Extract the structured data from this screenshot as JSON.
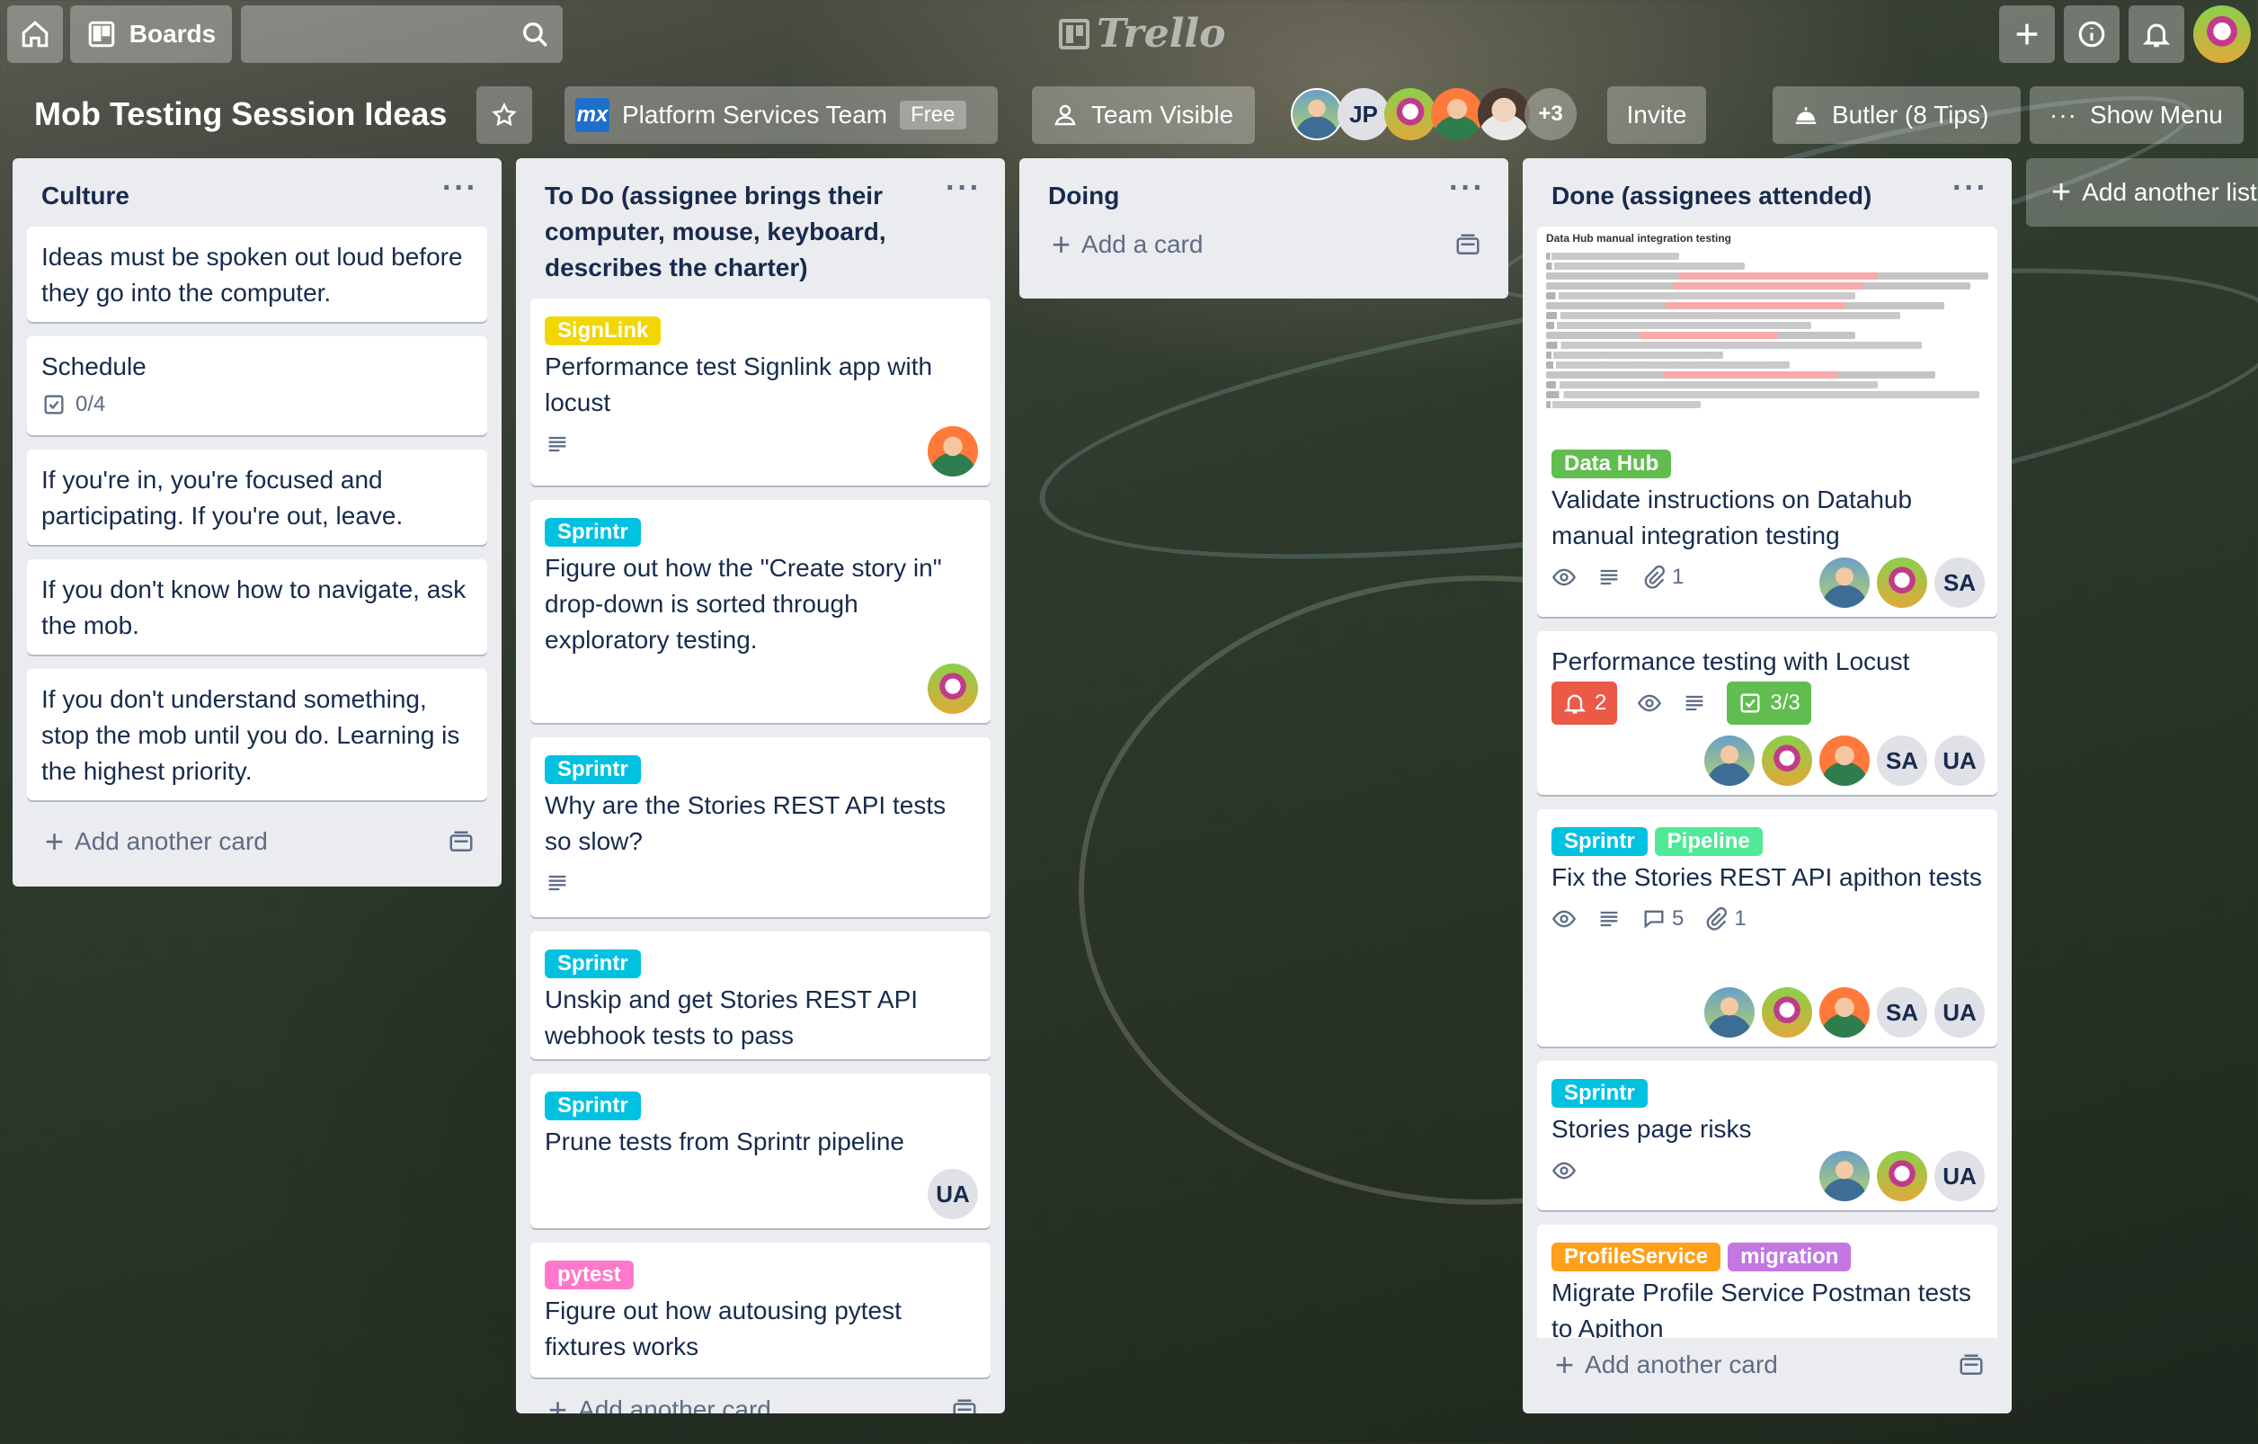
{
  "topbar": {
    "home_icon": "home-icon",
    "boards_label": "Boards",
    "search_placeholder": "",
    "logo_text": "Trello"
  },
  "header": {
    "board_title": "Mob Testing Session Ideas",
    "team_icon_text": "mx",
    "team_name": "Platform Services Team",
    "team_plan": "Free",
    "visibility": "Team Visible",
    "member_initials": "JP",
    "more_members": "+3",
    "invite_label": "Invite",
    "butler_label": "Butler (8 Tips)",
    "menu_label": "Show Menu",
    "add_list_label": "Add another list"
  },
  "lists": [
    {
      "title": "Culture",
      "cards": [
        {
          "text": "Ideas must be spoken out loud before they go into the computer."
        },
        {
          "text": "Schedule",
          "checklist": "0/4"
        },
        {
          "text": "If you're in, you're focused and participating. If you're out, leave."
        },
        {
          "text": "If you don't know how to navigate, ask the mob."
        },
        {
          "text": "If you don't understand something, stop the mob until you do. Learning is the highest priority."
        }
      ],
      "add_label": "Add another card"
    },
    {
      "title": "To Do (assignee brings their computer, mouse, keyboard, describes the charter)",
      "cards": [
        {
          "label": "SignLink",
          "text": "Performance test Signlink app with locust"
        },
        {
          "label": "Sprintr",
          "text": "Figure out how the \"Create story in\" drop-down is sorted through exploratory testing."
        },
        {
          "label": "Sprintr",
          "text": "Why are the Stories REST API tests so slow?"
        },
        {
          "label": "Sprintr",
          "text": "Unskip and get Stories REST API webhook tests to pass"
        },
        {
          "label": "Sprintr",
          "text": "Prune tests from Sprintr pipeline",
          "member": "UA"
        },
        {
          "label": "pytest",
          "text": "Figure out how autousing pytest fixtures works"
        }
      ],
      "add_label": "Add another card"
    },
    {
      "title": "Doing",
      "add_label": "Add a card"
    },
    {
      "title": "Done (assignees attended)",
      "cards": [
        {
          "cover_title": "Data Hub manual integration testing",
          "label": "Data Hub",
          "text": "Validate instructions on Datahub manual integration testing",
          "attachments": "1",
          "member": "SA"
        },
        {
          "text": "Performance testing with Locust",
          "due": "2",
          "checklist": "3/3",
          "members": [
            "SA",
            "UA"
          ]
        },
        {
          "labels": [
            "Sprintr",
            "Pipeline"
          ],
          "text": "Fix the Stories REST API apithon tests",
          "comments": "5",
          "attachments": "1",
          "members": [
            "SA",
            "UA"
          ]
        },
        {
          "label": "Sprintr",
          "text": "Stories page risks",
          "member": "UA"
        },
        {
          "labels": [
            "ProfileService",
            "migration"
          ],
          "text": "Migrate Profile Service Postman tests to Apithon"
        }
      ],
      "add_label": "Add another card"
    }
  ],
  "colors": {
    "sky": "#00c2e0",
    "yellow": "#f2d600",
    "green": "#61bd4f",
    "lime": "#51e898",
    "orange": "#ff9f1a",
    "purple": "#c377e0",
    "pink": "#ff78cb",
    "red": "#eb5a46"
  }
}
